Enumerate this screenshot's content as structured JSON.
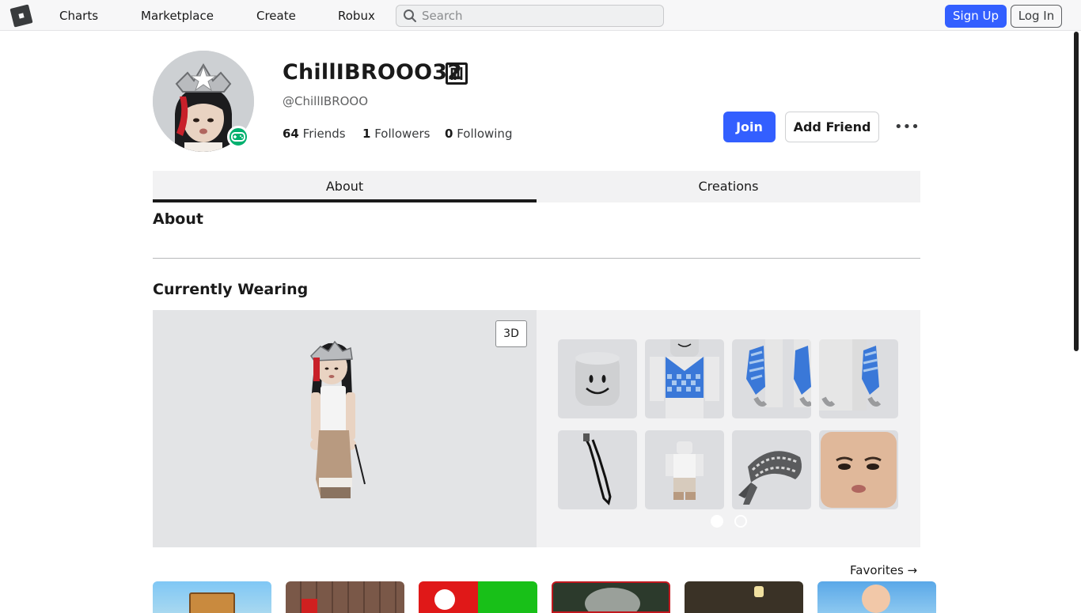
{
  "nav": {
    "links": [
      "Charts",
      "Marketplace",
      "Create",
      "Robux"
    ],
    "search_placeholder": "Search",
    "signup_label": "Sign Up",
    "login_label": "Log In"
  },
  "profile": {
    "display_name": "ChillIBROOO32",
    "username": "@ChillIBROOO",
    "friends_count": "64",
    "friends_label": "Friends",
    "followers_count": "1",
    "followers_label": "Followers",
    "following_count": "0",
    "following_label": "Following",
    "join_label": "Join",
    "add_friend_label": "Add Friend",
    "more_label": "•••"
  },
  "tabs": [
    {
      "label": "About",
      "active": true
    },
    {
      "label": "Creations",
      "active": false
    }
  ],
  "about": {
    "title": "About"
  },
  "wearing": {
    "title": "Currently Wearing",
    "viewer_toggle": "3D",
    "items": [
      "head",
      "shirt",
      "arms-left",
      "arms-right",
      "strap",
      "outfit",
      "bandana",
      "face"
    ],
    "pages": 2,
    "current_page": 1
  },
  "favorites": {
    "label": "Favorites →"
  },
  "colors": {
    "brand_blue": "#335fff",
    "online_green": "#00b06f"
  }
}
